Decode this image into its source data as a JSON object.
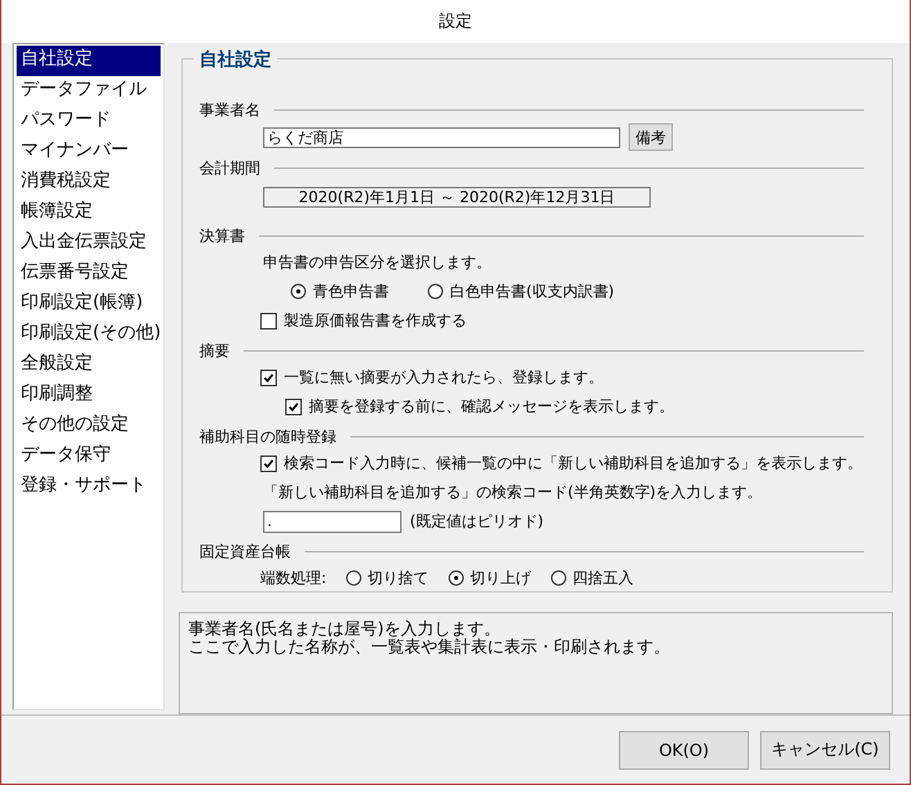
{
  "window": {
    "title": "設定"
  },
  "sidebar": {
    "items": [
      {
        "label": "自社設定",
        "selected": true
      },
      {
        "label": "データファイル",
        "selected": false
      },
      {
        "label": "パスワード",
        "selected": false
      },
      {
        "label": "マイナンバー",
        "selected": false
      },
      {
        "label": "消費税設定",
        "selected": false
      },
      {
        "label": "帳簿設定",
        "selected": false
      },
      {
        "label": "入出金伝票設定",
        "selected": false
      },
      {
        "label": "伝票番号設定",
        "selected": false
      },
      {
        "label": "印刷設定(帳簿)",
        "selected": false
      },
      {
        "label": "印刷設定(その他)",
        "selected": false
      },
      {
        "label": "全般設定",
        "selected": false
      },
      {
        "label": "印刷調整",
        "selected": false
      },
      {
        "label": "その他の設定",
        "selected": false
      },
      {
        "label": "データ保守",
        "selected": false
      },
      {
        "label": "登録・サポート",
        "selected": false
      }
    ]
  },
  "section": {
    "title": "自社設定",
    "groups": [
      {
        "heading": "事業者名",
        "rows": [
          {
            "kind": "field",
            "value": "らくだ商店",
            "button": "備考"
          }
        ]
      },
      {
        "heading": "会計期間",
        "rows": [
          {
            "kind": "readonly",
            "value": "2020(R2)年1月1日 ～ 2020(R2)年12月31日"
          }
        ]
      },
      {
        "heading": "決算書",
        "rows": [
          {
            "kind": "label",
            "text": "申告書の申告区分を選択します。"
          },
          {
            "kind": "radios",
            "options": [
              {
                "label": "青色申告書",
                "selected": true
              },
              {
                "label": "白色申告書(収支内訳書)",
                "selected": false
              }
            ]
          },
          {
            "kind": "checkbox",
            "label": "製造原価報告書を作成する",
            "checked": false
          }
        ]
      },
      {
        "heading": "摘要",
        "rows": [
          {
            "kind": "checkbox",
            "label": "一覧に無い摘要が入力されたら、登録します。",
            "checked": true,
            "children": [
              {
                "kind": "checkbox",
                "label": "摘要を登録する前に、確認メッセージを表示します。",
                "checked": true
              }
            ]
          }
        ]
      },
      {
        "heading": "補助科目の随時登録",
        "rows": [
          {
            "kind": "checkbox",
            "label": "検索コード入力時に、候補一覧の中に「新しい補助科目を追加する」を表示します。",
            "checked": true
          },
          {
            "kind": "label",
            "text": "「新しい補助科目を追加する」の検索コード(半角英数字)を入力します。"
          },
          {
            "kind": "field_note",
            "value": ".",
            "note": "(既定値はピリオド)"
          }
        ]
      },
      {
        "heading": "固定資産台帳",
        "rows": [
          {
            "kind": "radios",
            "label": "端数処理:",
            "options": [
              {
                "label": "切り捨て",
                "selected": false
              },
              {
                "label": "切り上げ",
                "selected": true
              },
              {
                "label": "四捨五入",
                "selected": false
              }
            ]
          }
        ]
      }
    ]
  },
  "help": {
    "lines": [
      "事業者名(氏名または屋号)を入力します。",
      "ここで入力した名称が、一覧表や集計表に表示・印刷されます。"
    ]
  },
  "buttons": [
    "OK(O)",
    "キャンセル(C)"
  ]
}
